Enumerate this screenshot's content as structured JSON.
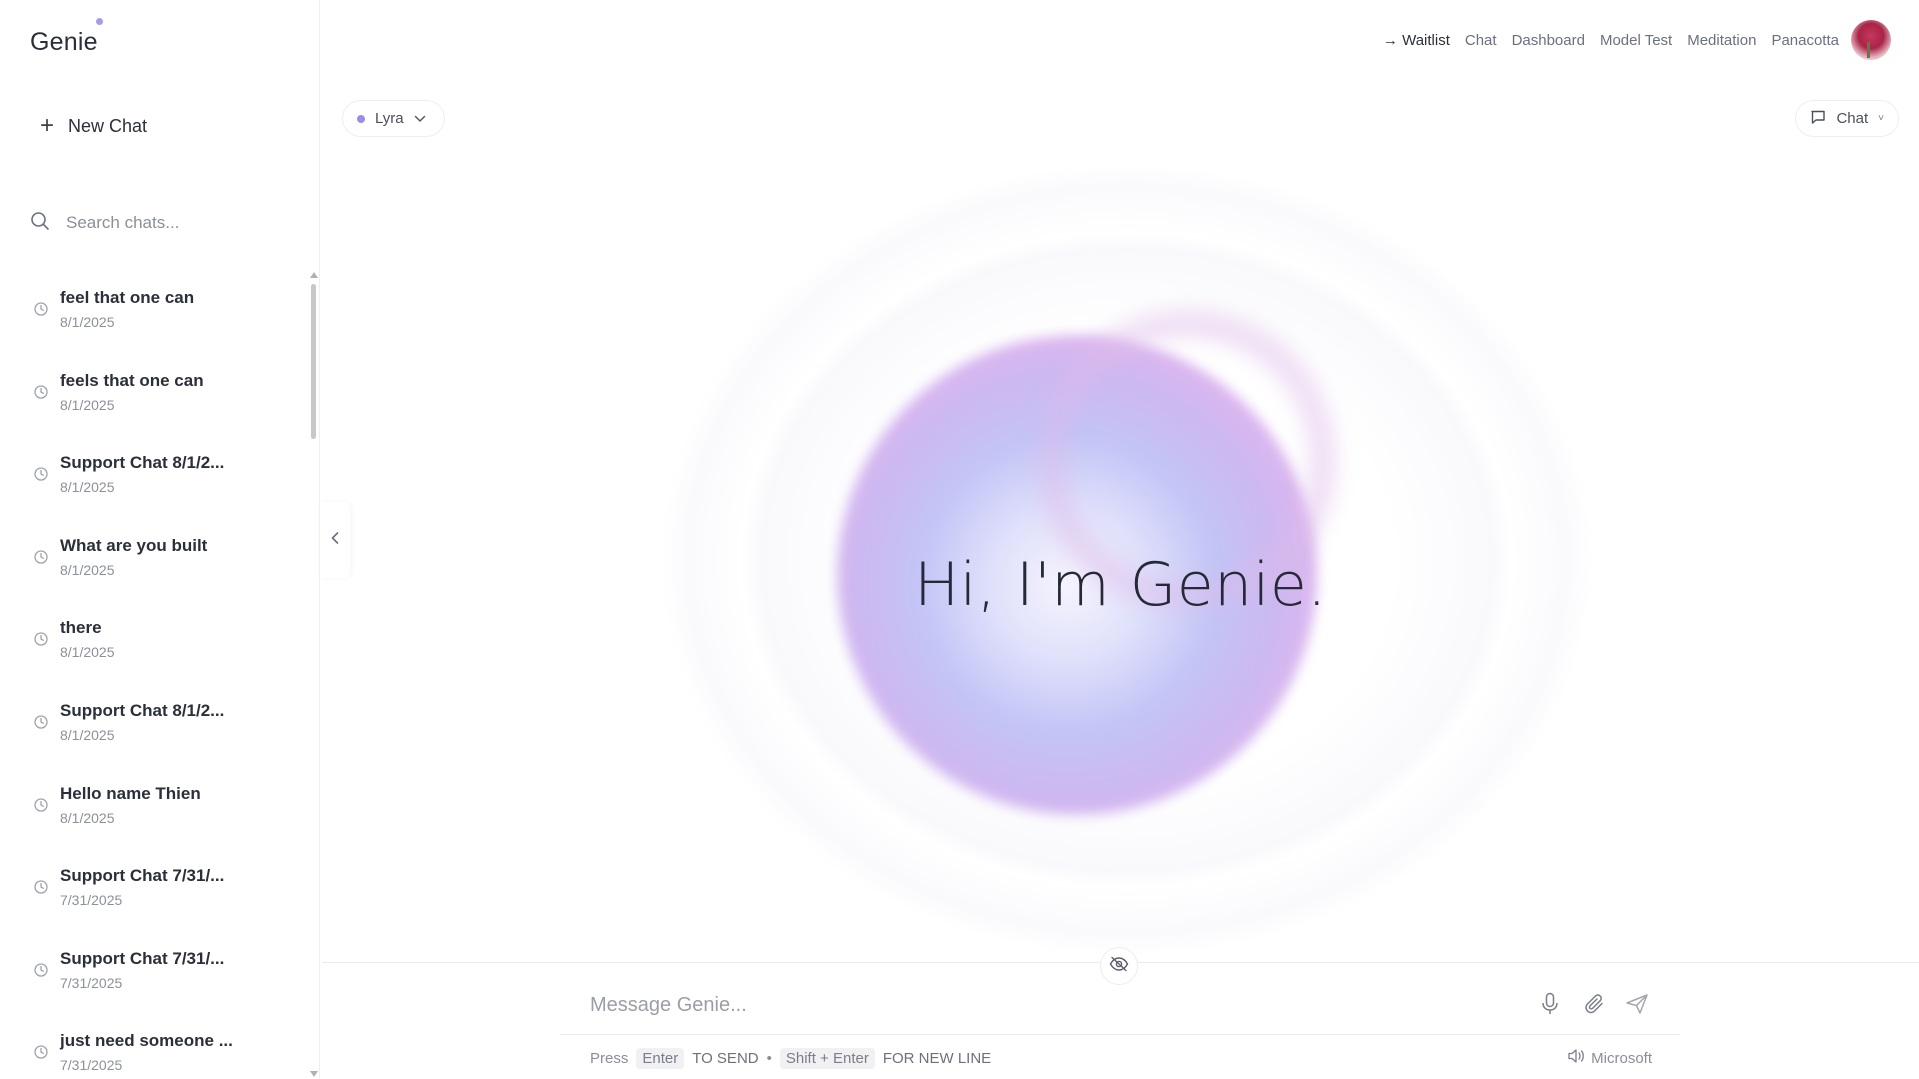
{
  "app": {
    "logo": "Genie"
  },
  "sidebar": {
    "new_chat_label": "New Chat",
    "search_placeholder": "Search chats...",
    "chats": [
      {
        "title": "feel that one can",
        "date": "8/1/2025"
      },
      {
        "title": "feels that one can",
        "date": "8/1/2025"
      },
      {
        "title": "Support Chat 8/1/2...",
        "date": "8/1/2025"
      },
      {
        "title": "What are you built",
        "date": "8/1/2025"
      },
      {
        "title": "there",
        "date": "8/1/2025"
      },
      {
        "title": "Support Chat 8/1/2...",
        "date": "8/1/2025"
      },
      {
        "title": "Hello name Thien",
        "date": "8/1/2025"
      },
      {
        "title": "Support Chat 7/31/...",
        "date": "7/31/2025"
      },
      {
        "title": "Support Chat 7/31/...",
        "date": "7/31/2025"
      },
      {
        "title": "just need someone ...",
        "date": "7/31/2025"
      }
    ]
  },
  "nav": {
    "waitlist": "→ Waitlist",
    "chat": "Chat",
    "dashboard": "Dashboard",
    "model_test": "Model Test",
    "meditation": "Meditation",
    "user_name": "Panacotta"
  },
  "controls": {
    "model_label": "Lyra",
    "mode_label": "Chat"
  },
  "hero": {
    "greeting": "Hi, I'm Genie."
  },
  "composer": {
    "placeholder": "Message Genie...",
    "hint_press": "Press",
    "hint_enter": "Enter",
    "hint_to_send": "TO SEND",
    "hint_bullet": "•",
    "hint_shift_enter": "Shift + Enter",
    "hint_new_line": "FOR NEW LINE",
    "voice_label": "Microsoft"
  },
  "colors": {
    "accent": "#9a8de8",
    "orb": "#c3c4f6",
    "text": "#2b2f3a",
    "muted": "#8b909a"
  },
  "icons": [
    "plus-icon",
    "search-icon",
    "clock-icon",
    "chevron-left-icon",
    "chevron-down-icon",
    "chat-bubble-icon",
    "eye-off-icon",
    "microphone-icon",
    "paperclip-icon",
    "send-icon",
    "speaker-icon"
  ]
}
